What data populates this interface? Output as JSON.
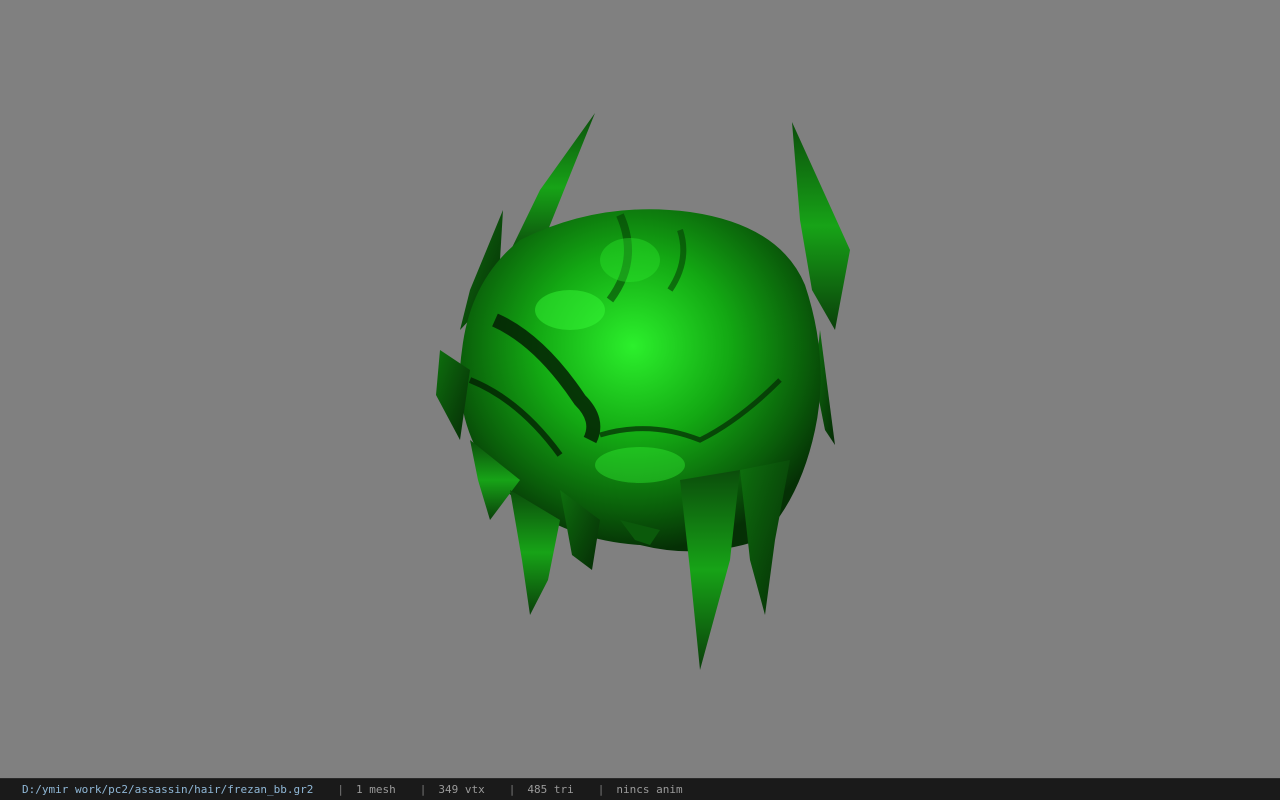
{
  "viewer": {
    "background_color": "#808080",
    "model_tint": "#1fd11f"
  },
  "status_bar": {
    "file_path": "D:/ymir work/pc2/assassin/hair/frezan_bb.gr2",
    "separator": "|",
    "mesh_count": "1 mesh",
    "vertex_count": "349 vtx",
    "triangle_count": "485 tri",
    "animation": "nincs anim"
  }
}
